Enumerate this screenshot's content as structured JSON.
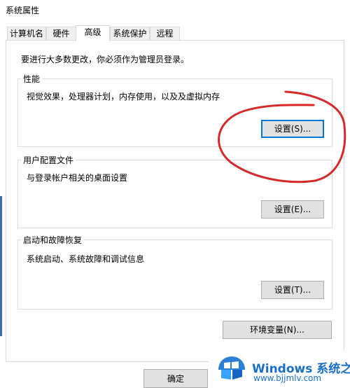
{
  "window": {
    "title": "系统属性"
  },
  "tabs": [
    {
      "label": "计算机名"
    },
    {
      "label": "硬件"
    },
    {
      "label": "高级"
    },
    {
      "label": "系统保护"
    },
    {
      "label": "远程"
    }
  ],
  "admin_note": "要进行大多数更改，你必须作为管理员登录。",
  "performance": {
    "title": "性能",
    "description": "视觉效果，处理器计划，内存使用，以及及虚拟内存",
    "button": "设置(S)..."
  },
  "user_profiles": {
    "title": "用户配置文件",
    "description": "与登录帐户相关的桌面设置",
    "button": "设置(E)..."
  },
  "startup": {
    "title": "启动和故障恢复",
    "description": "系统启动、系统故障和调试信息",
    "button": "设置(T)..."
  },
  "env_button": "环境变量(N)...",
  "ok_button": "确定",
  "watermark": {
    "brand": "Windows 系统之家",
    "url": "www.bjjmlv.com",
    "logo_icon": "windows-logo-icon"
  },
  "annotation_color": "#d42a2a"
}
